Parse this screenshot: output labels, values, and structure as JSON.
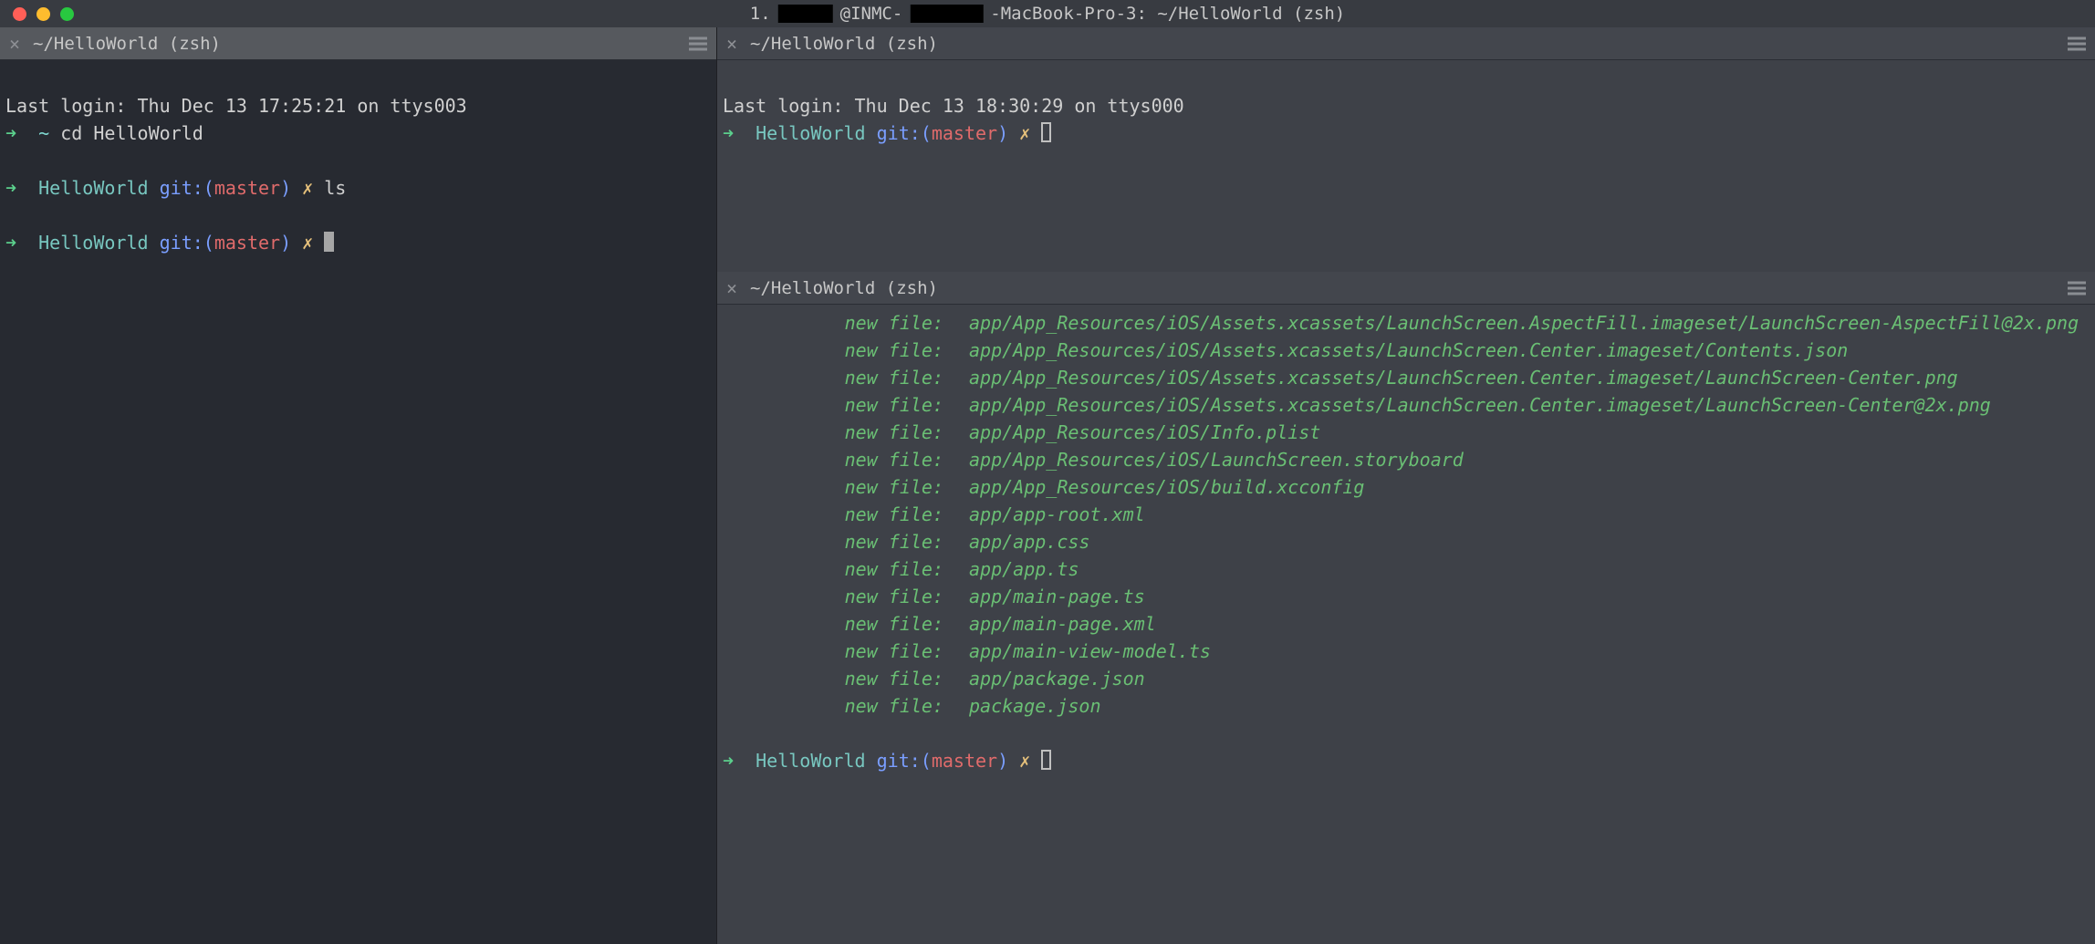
{
  "window": {
    "title_prefix": "1.",
    "title_mid": "@INMC-",
    "title_suffix": "-MacBook-Pro-3: ~/HelloWorld (zsh)"
  },
  "tabs": {
    "left": "~/HelloWorld (zsh)",
    "right_top": "~/HelloWorld (zsh)",
    "right_bottom": "~/HelloWorld (zsh)"
  },
  "left_pane": {
    "last_login": "Last login: Thu Dec 13 17:25:21 on ttys003",
    "line1_dir": "~",
    "line1_cmd": "cd HelloWorld",
    "line2_dir": "HelloWorld",
    "line2_git": "git:(",
    "line2_branch": "master",
    "line2_close": ")",
    "line2_cmd": "ls",
    "line3_dir": "HelloWorld",
    "line3_git": "git:(",
    "line3_branch": "master",
    "line3_close": ")"
  },
  "right_top": {
    "last_login": "Last login: Thu Dec 13 18:30:29 on ttys000",
    "dir": "HelloWorld",
    "git": "git:(",
    "branch": "master",
    "close": ")"
  },
  "right_bottom": {
    "status_label": "new file:",
    "files": [
      "app/App_Resources/iOS/Assets.xcassets/LaunchScreen.AspectFill.imageset/LaunchScreen-AspectFill@2x.png",
      "app/App_Resources/iOS/Assets.xcassets/LaunchScreen.Center.imageset/Contents.json",
      "app/App_Resources/iOS/Assets.xcassets/LaunchScreen.Center.imageset/LaunchScreen-Center.png",
      "app/App_Resources/iOS/Assets.xcassets/LaunchScreen.Center.imageset/LaunchScreen-Center@2x.png",
      "app/App_Resources/iOS/Info.plist",
      "app/App_Resources/iOS/LaunchScreen.storyboard",
      "app/App_Resources/iOS/build.xcconfig",
      "app/app-root.xml",
      "app/app.css",
      "app/app.ts",
      "app/main-page.ts",
      "app/main-page.xml",
      "app/main-view-model.ts",
      "app/package.json",
      "package.json"
    ],
    "prompt_dir": "HelloWorld",
    "prompt_git": "git:(",
    "prompt_branch": "master",
    "prompt_close": ")"
  },
  "glyphs": {
    "arrow": "➜",
    "x": "✗"
  }
}
